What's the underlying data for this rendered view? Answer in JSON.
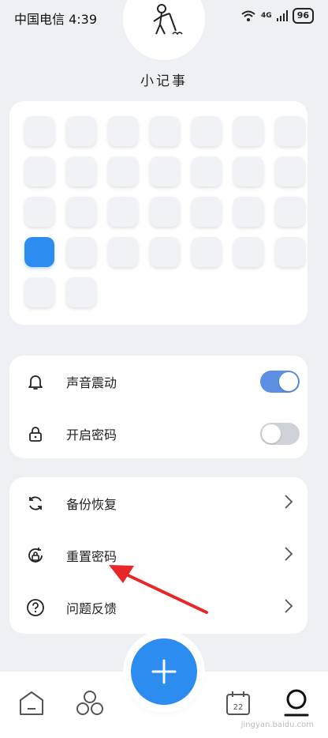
{
  "status_bar": {
    "carrier_time": "中国电信 4:39",
    "network": "4G",
    "battery": "96"
  },
  "header": {
    "app_name": "小记事",
    "avatar_icon": "doodle-avatar-icon"
  },
  "calendar": {
    "total_cells": 30,
    "active_index": 21,
    "colors": {
      "cell": "#f1f2f5",
      "active": "#2d8cf0"
    }
  },
  "settings": [
    {
      "id": "sound",
      "label": "声音震动",
      "icon": "bell-icon",
      "toggle": true
    },
    {
      "id": "password",
      "label": "开启密码",
      "icon": "lock-icon",
      "toggle": false
    }
  ],
  "actions": [
    {
      "id": "backup",
      "label": "备份恢复",
      "icon": "sync-icon"
    },
    {
      "id": "reset",
      "label": "重置密码",
      "icon": "reset-lock-icon"
    },
    {
      "id": "help",
      "label": "问题反馈",
      "icon": "question-icon"
    }
  ],
  "nav": {
    "items": [
      "home-icon",
      "category-icon",
      "calendar-icon",
      "profile-icon"
    ],
    "calendar_day": "22",
    "fab_icon": "plus-icon"
  },
  "annotation": {
    "color": "#e8272b"
  },
  "watermark": "jingyan.baidu.com"
}
